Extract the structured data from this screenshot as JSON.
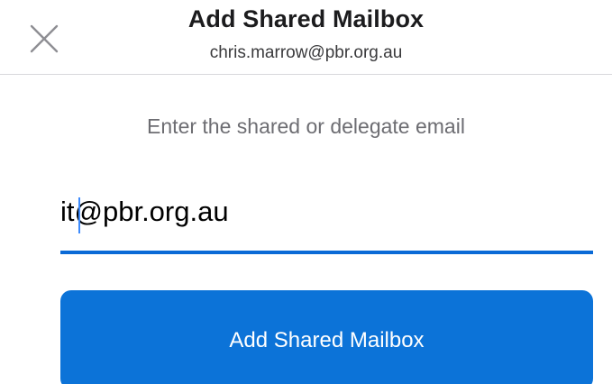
{
  "header": {
    "title": "Add Shared Mailbox",
    "account": "chris.marrow@pbr.org.au",
    "close_icon": "close-icon"
  },
  "form": {
    "prompt": "Enter the shared or delegate email",
    "email_value": "it@pbr.org.au",
    "submit_label": "Add Shared Mailbox"
  },
  "colors": {
    "accent": "#0c73d8",
    "underline": "#0a6ad6",
    "title": "#1c1c1e",
    "prompt": "#6d6d72"
  }
}
